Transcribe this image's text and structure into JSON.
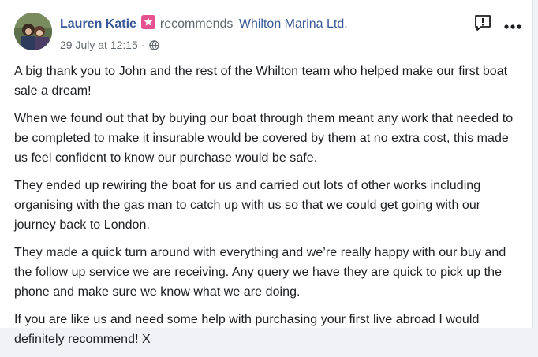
{
  "post": {
    "author": "Lauren Katie",
    "verb": "recommends",
    "page_name": "Whilton Marina Ltd.",
    "timestamp": "29 July at 12:15",
    "separator": "·",
    "icons": {
      "badge": "recommendation-badge-icon",
      "privacy": "globe-icon",
      "report": "report-icon",
      "more": "more-options-icon"
    },
    "paragraphs": [
      "A big thank you to John and the rest of the Whilton team who helped make our first boat sale a dream!",
      "When we found out that by buying our boat through them meant any work that needed to be completed to make it insurable would be covered by them at no extra cost, this made us feel confident to know our purchase would be safe.",
      "They ended up rewiring the boat for us and carried out lots of other works including organising with the gas man to catch up with us so that we could get going with our journey back to London.",
      "They made a quick turn around with everything and we’re really happy with our buy and the follow up service we are receiving. Any query we have they are quick to pick up the phone and make sure we know what we are doing.",
      "If you are like us and need some help with purchasing your first live abroad I would definitely recommend! X"
    ]
  },
  "colors": {
    "link": "#385898",
    "meta": "#616770",
    "text": "#1c1e21",
    "badge": "#e5528f"
  }
}
